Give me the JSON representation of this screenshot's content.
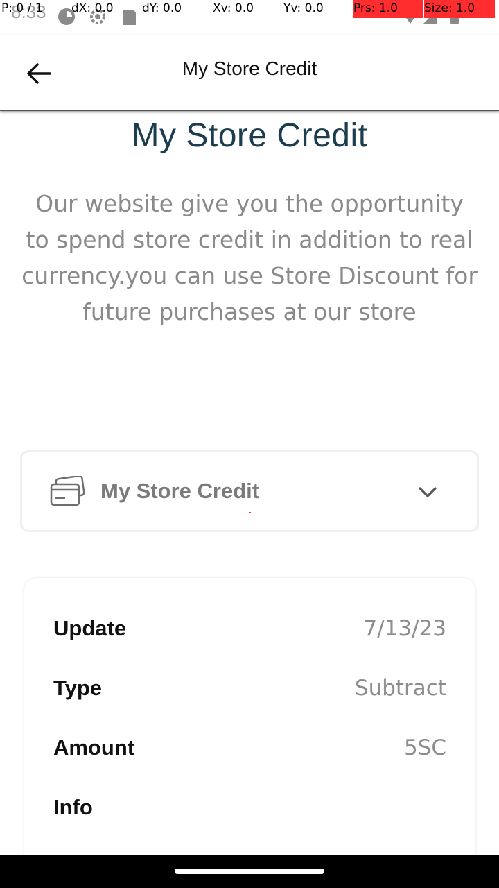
{
  "status_bar": {
    "time": "8:33",
    "icons": [
      "sync-icon",
      "settings-icon",
      "sd-card-icon",
      "wifi-icon",
      "signal-icon",
      "battery-icon"
    ]
  },
  "pointer_overlay": {
    "p": "P: 0 / 1",
    "dx": "dX: 0.0",
    "dy": "dY: 0.0",
    "xv": "Xv: 0.0",
    "yv": "Yv: 0.0",
    "prs": "Prs: 1.0",
    "size": "Size: 1.0",
    "highlight_color": "#ff2d2d"
  },
  "app_bar": {
    "title": "My Store Credit",
    "back_icon": "arrow-left-icon"
  },
  "main": {
    "heading": "My Store Credit",
    "heading_color": "#1c3d4f",
    "description": "Our website give you the opportunity to spend store credit in addition to real currency.you can use Store Discount for future purchases at our store"
  },
  "dropdown": {
    "label": "My Store Credit",
    "icon": "credit-card-icon",
    "chevron": "chevron-down-icon"
  },
  "credit_entry": {
    "rows": [
      {
        "key": "Update",
        "value": "7/13/23"
      },
      {
        "key": "Type",
        "value": "Subtract"
      },
      {
        "key": "Amount",
        "value": "5SC"
      },
      {
        "key": "Info",
        "value": ""
      }
    ]
  }
}
